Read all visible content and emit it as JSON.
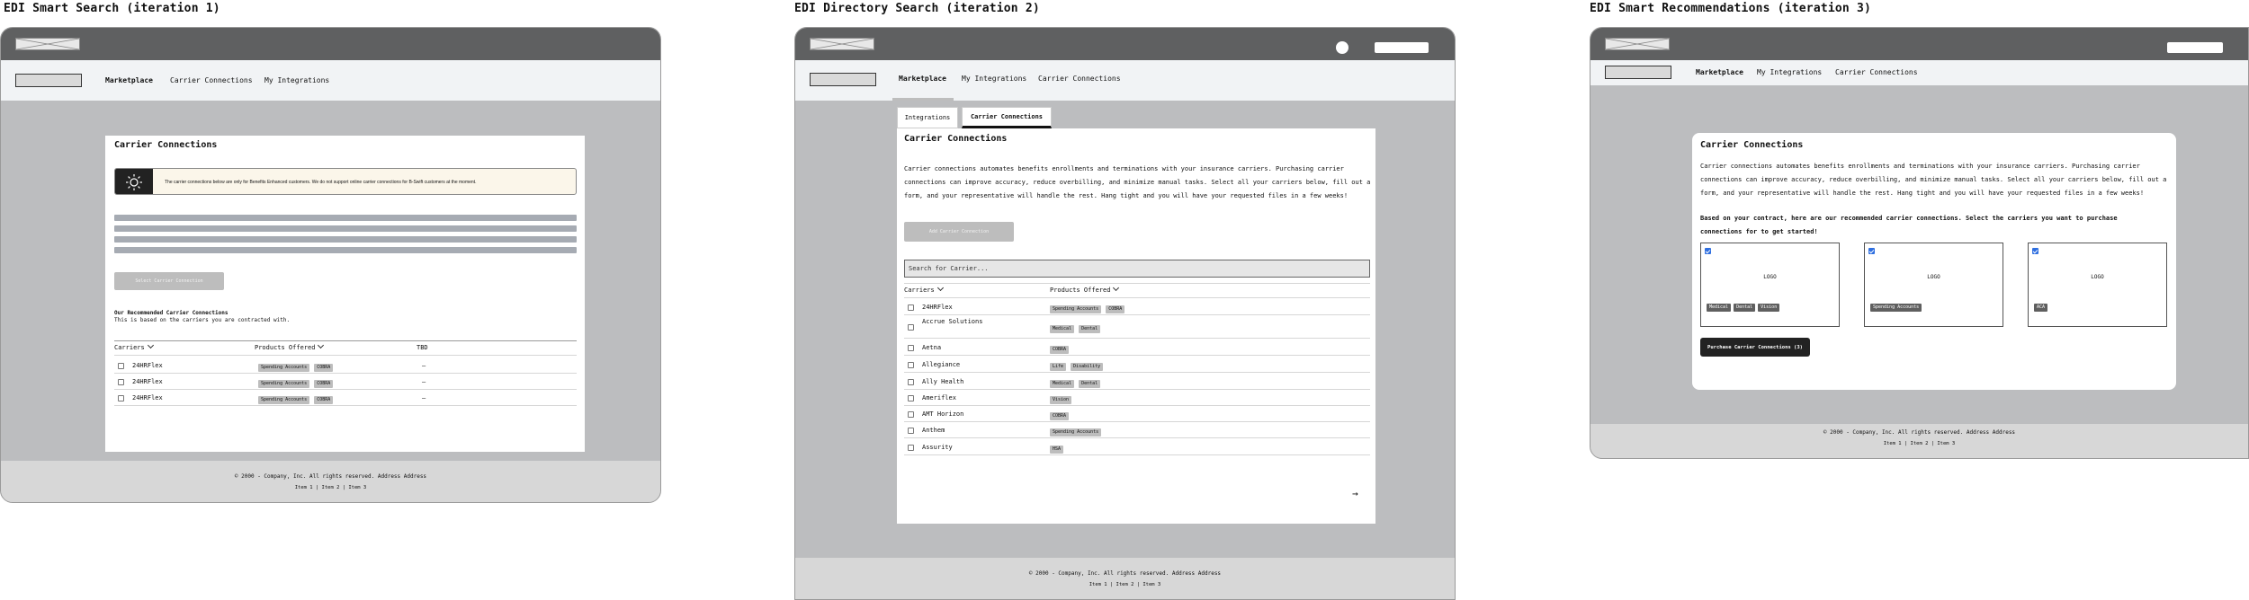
{
  "frames": [
    {
      "title": "EDI Smart Search (iteration 1)",
      "nav": {
        "items": [
          "Marketplace",
          "Carrier Connections",
          "My Integrations"
        ],
        "active": "Marketplace"
      },
      "card": {
        "title": "Carrier Connections",
        "alert": "The carrier connections below are only for Benefits Enhanced customers. We do not support online carrier connections for B-Swift customers at the moment.",
        "button": "Select Carrier Connection",
        "rec_title": "Our Recommended Carrier Connections",
        "rec_subtitle": "This is based on the carriers you are contracted with.",
        "columns": [
          "Carriers",
          "Products Offered",
          "TBD"
        ],
        "rows": [
          {
            "carrier": "24HRFlex",
            "products": [
              "Spending Accounts",
              "COBRA"
            ],
            "tbd": "—"
          },
          {
            "carrier": "24HRFlex",
            "products": [
              "Spending Accounts",
              "COBRA"
            ],
            "tbd": "—"
          },
          {
            "carrier": "24HRFlex",
            "products": [
              "Spending Accounts",
              "COBRA"
            ],
            "tbd": "—"
          }
        ]
      },
      "footer": {
        "copy": "© 2000 - Company, Inc. All rights reserved. Address Address",
        "links": "Item 1 | Item 2 | Item 3"
      }
    },
    {
      "title": "EDI Directory Search (iteration 2)",
      "nav": {
        "items": [
          "Marketplace",
          "My Integrations",
          "Carrier Connections"
        ],
        "active": "Marketplace"
      },
      "tabs": [
        "Integrations",
        "Carrier Connections"
      ],
      "active_tab": "Carrier Connections",
      "card": {
        "title": "Carrier Connections",
        "description": "Carrier connections automates benefits enrollments and terminations with your insurance carriers. Purchasing carrier connections can improve accuracy, reduce overbilling, and minimize manual tasks. Select all your carriers below, fill out a form, and your representative will handle the rest. Hang tight and you will have your requested files in a few weeks!",
        "button": "Add Carrier Connection",
        "search_placeholder": "Search for Carrier...",
        "columns": [
          "Carriers",
          "Products Offered"
        ],
        "rows": [
          {
            "carrier": "24HRFlex",
            "products": [
              "Spending Accounts",
              "COBRA"
            ]
          },
          {
            "carrier": "Accrue Solutions",
            "products": [
              "Medical",
              "Dental"
            ]
          },
          {
            "carrier": "Aetna",
            "products": [
              "COBRA"
            ]
          },
          {
            "carrier": "Allegiance",
            "products": [
              "Life",
              "Disability"
            ]
          },
          {
            "carrier": "Ally Health",
            "products": [
              "Medical",
              "Dental"
            ]
          },
          {
            "carrier": "Ameriflex",
            "products": [
              "Vision"
            ]
          },
          {
            "carrier": "AMT Horizon",
            "products": [
              "COBRA"
            ]
          },
          {
            "carrier": "Anthem",
            "products": [
              "Spending Accounts"
            ]
          },
          {
            "carrier": "Assurity",
            "products": [
              "HSA"
            ]
          }
        ],
        "next_arrow": "→"
      },
      "footer": {
        "copy": "© 2000 - Company, Inc. All rights reserved. Address Address",
        "links": "Item 1 | Item 2 | Item 3"
      }
    },
    {
      "title": "EDI Smart Recommendations (iteration 3)",
      "nav": {
        "items": [
          "Marketplace",
          "My Integrations",
          "Carrier Connections"
        ],
        "active": "Marketplace"
      },
      "card": {
        "title": "Carrier Connections",
        "description": "Carrier connections automates benefits enrollments and terminations with your insurance carriers. Purchasing carrier connections can improve accuracy, reduce overbilling, and minimize manual tasks. Select all your carriers below, fill out a form, and your representative will handle the rest. Hang tight and you will have your requested files in a few weeks!",
        "prompt": "Based on your contract, here are our recommended carrier connections. Select the carriers you want to purchase connections for to get started!",
        "cards": [
          {
            "logo": "LOGO",
            "tags": [
              "Medical",
              "Dental",
              "Vision"
            ]
          },
          {
            "logo": "LOGO",
            "tags": [
              "Spending Accounts"
            ]
          },
          {
            "logo": "LOGO",
            "tags": [
              "ACA"
            ]
          }
        ],
        "button": "Purchase Carrier Connections (3)"
      },
      "footer": {
        "copy": "© 2000 - Company, Inc. All rights reserved. Address Address",
        "links": "Item 1 | Item 2 | Item 3"
      }
    }
  ]
}
